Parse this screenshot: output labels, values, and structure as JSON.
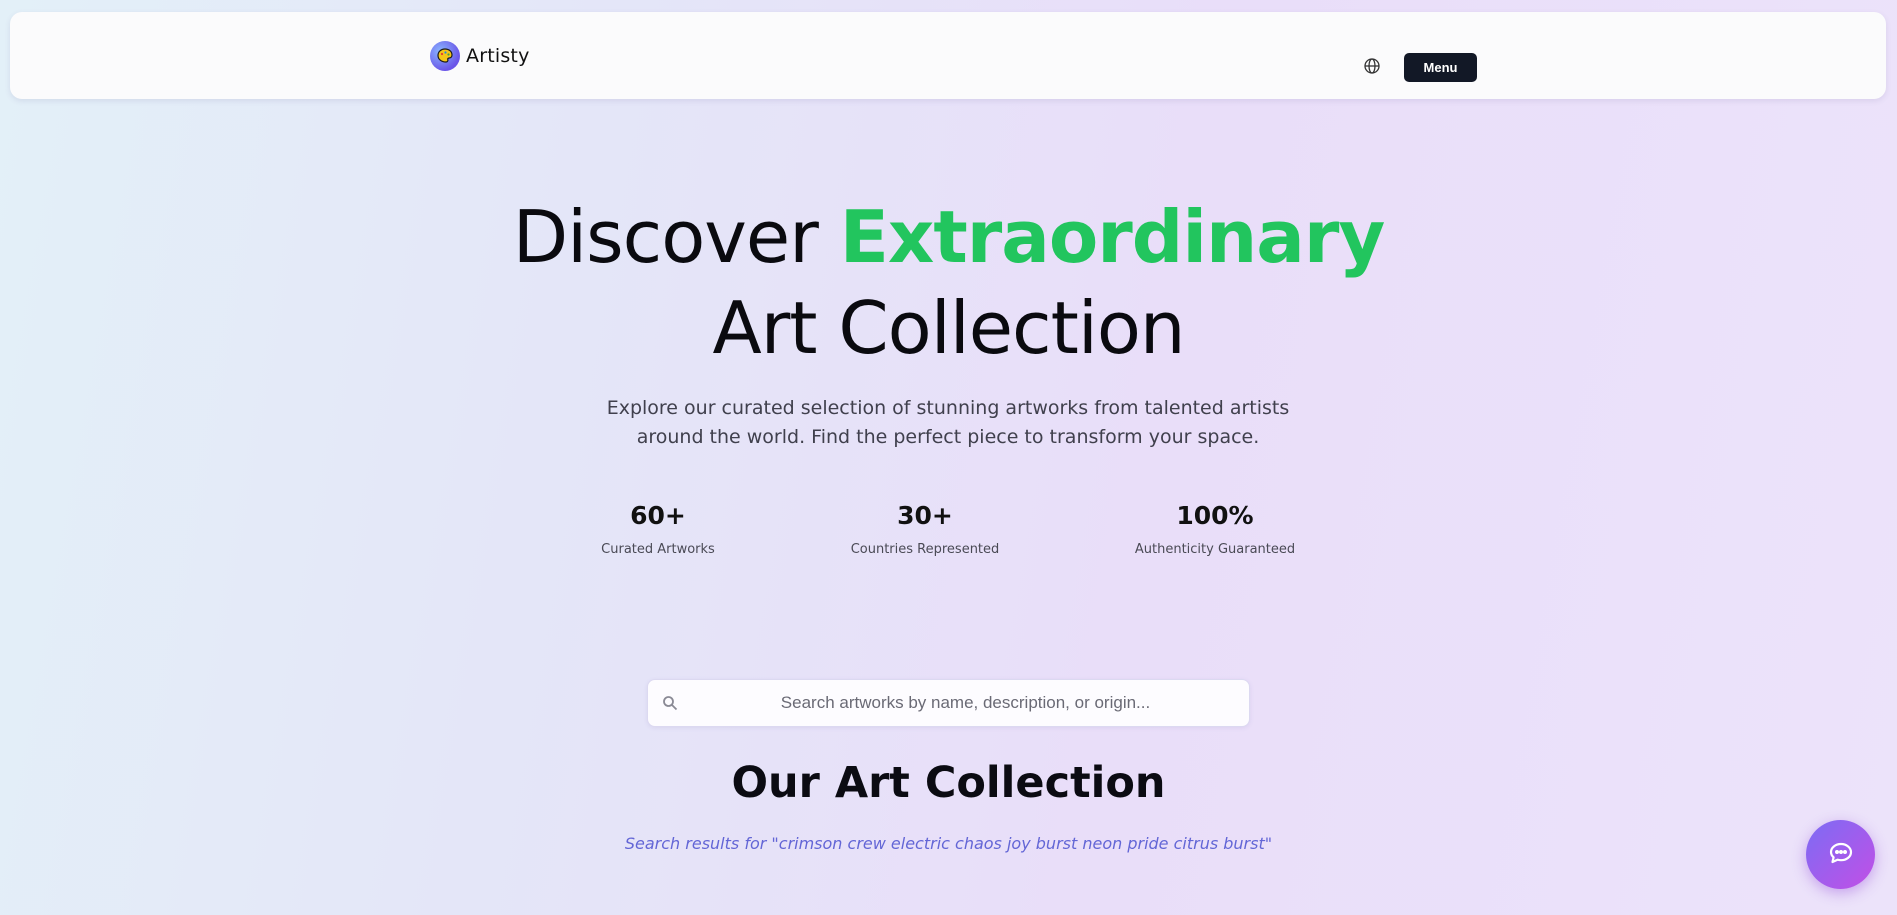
{
  "brand": {
    "name": "Artisty"
  },
  "nav": {
    "menu_label": "Menu",
    "language_icon": "globe-icon"
  },
  "hero": {
    "title_pre": "Discover ",
    "title_accent": "Extraordinary",
    "title_line2": "Art Collection",
    "subtitle_line1": "Explore our curated selection of stunning artworks from talented artists",
    "subtitle_line2": "around the world. Find the perfect piece to transform your space.",
    "accent_color": "#22c55e"
  },
  "stats": [
    {
      "value": "60+",
      "label": "Curated Artworks"
    },
    {
      "value": "30+",
      "label": "Countries Represented"
    },
    {
      "value": "100%",
      "label": "Authenticity Guaranteed"
    }
  ],
  "search": {
    "placeholder": "Search artworks by name, description, or origin...",
    "value": "",
    "icon": "search-icon"
  },
  "collection": {
    "title": "Our Art Collection",
    "results_text": "Search results for \"crimson crew electric chaos joy burst neon pride citrus burst\""
  },
  "chat": {
    "icon": "chat-bubble-icon"
  }
}
